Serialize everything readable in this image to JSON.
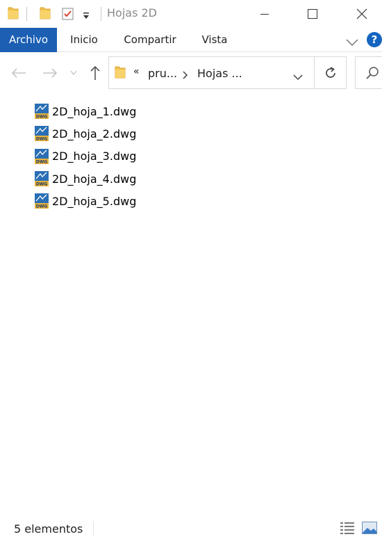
{
  "window": {
    "title": "Hojas 2D"
  },
  "ribbon": {
    "tabs": [
      {
        "label": "Archivo",
        "active": true
      },
      {
        "label": "Inicio",
        "active": false
      },
      {
        "label": "Compartir",
        "active": false
      },
      {
        "label": "Vista",
        "active": false
      }
    ],
    "help_label": "?"
  },
  "address": {
    "overflow": "«",
    "crumbs": [
      "pru...",
      "Hojas ..."
    ]
  },
  "files": [
    {
      "name": "2D_hoja_1.dwg",
      "icon": "dwg-file-icon"
    },
    {
      "name": "2D_hoja_2.dwg",
      "icon": "dwg-file-icon"
    },
    {
      "name": "2D_hoja_3.dwg",
      "icon": "dwg-file-icon"
    },
    {
      "name": "2D_hoja_4.dwg",
      "icon": "dwg-file-icon"
    },
    {
      "name": "2D_hoja_5.dwg",
      "icon": "dwg-file-icon"
    }
  ],
  "status": {
    "count_text": "5 elementos"
  },
  "colors": {
    "accent": "#1c5fb3",
    "folder": "#f2c14e",
    "dwg_blue": "#2a6fb5",
    "dwg_gold": "#e8b23a"
  }
}
